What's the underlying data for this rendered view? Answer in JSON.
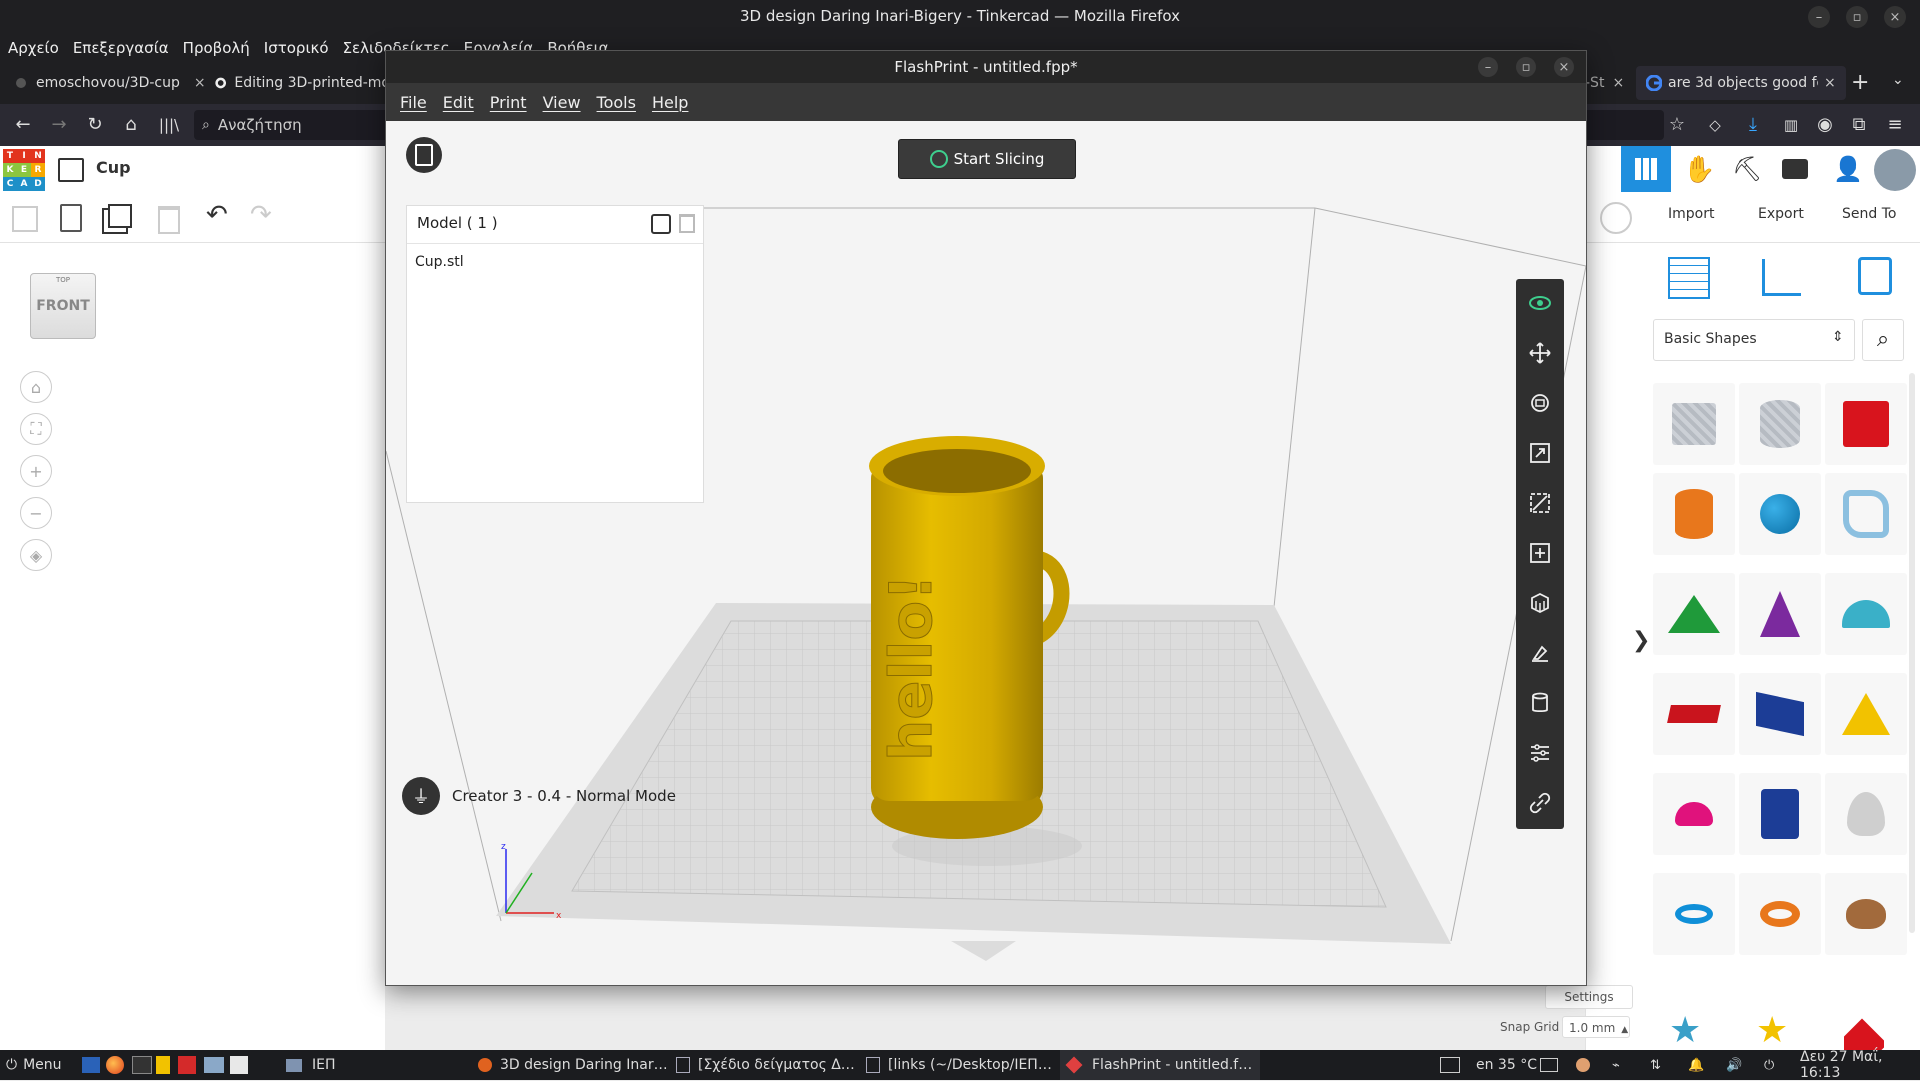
{
  "firefox": {
    "title": "3D design Daring Inari-Bigery - Tinkercad — Mozilla Firefox",
    "menu": [
      "Αρχείο",
      "Επεξεργασία",
      "Προβολή",
      "Ιστορικό",
      "Σελιδοδείκτες",
      "Εργαλεία",
      "Βοήθεια"
    ],
    "tabs": [
      {
        "label": "emoschovou/3D-cup"
      },
      {
        "label": "Editing 3D-printed-mo"
      },
      {
        "label": "-St"
      },
      {
        "label": "are 3d objects good fo"
      }
    ],
    "url_placeholder": "Αναζήτηση"
  },
  "tinkercad": {
    "design_name": "Cup",
    "logo_letters": [
      "T",
      "I",
      "N",
      "K",
      "E",
      "R",
      "C",
      "A",
      "D"
    ],
    "buttons": {
      "import": "Import",
      "export": "Export",
      "send_to": "Send To"
    },
    "viewcube": {
      "top": "TOP",
      "front": "FRONT"
    },
    "shapes_dropdown": "Basic Shapes",
    "settings_label": "Settings",
    "snap_grid_label": "Snap Grid",
    "snap_grid_value": "1.0 mm"
  },
  "flashprint": {
    "title": "FlashPrint - untitled.fpp*",
    "menu": [
      "File",
      "Edit",
      "Print",
      "View",
      "Tools",
      "Help"
    ],
    "start_slicing": "Start Slicing",
    "model_header": "Model ( 1 )",
    "models": [
      "Cup.stl"
    ],
    "printer_status": "Creator 3 - 0.4 - Normal Mode",
    "mug_text": "hello!",
    "axis_labels": {
      "x": "x",
      "z": "z"
    },
    "right_tools": [
      "view-icon",
      "move-icon",
      "rotate-icon",
      "scale-icon",
      "cut-icon",
      "add-icon",
      "support-icon",
      "lay-flat-icon",
      "cylinder-icon",
      "settings-sliders-icon",
      "link-icon"
    ]
  },
  "taskbar": {
    "menu_label": "Menu",
    "folder_label": "ΙΕΠ",
    "windows": [
      "3D design Daring Inar…",
      "[Σχέδιο δείγματος Δ…",
      "[links (~/Desktop/ΙΕΠ…",
      "FlashPrint - untitled.f…"
    ],
    "weather": "en 35 °C",
    "clock": "Δευ 27 Μαΐ, 16:13"
  }
}
